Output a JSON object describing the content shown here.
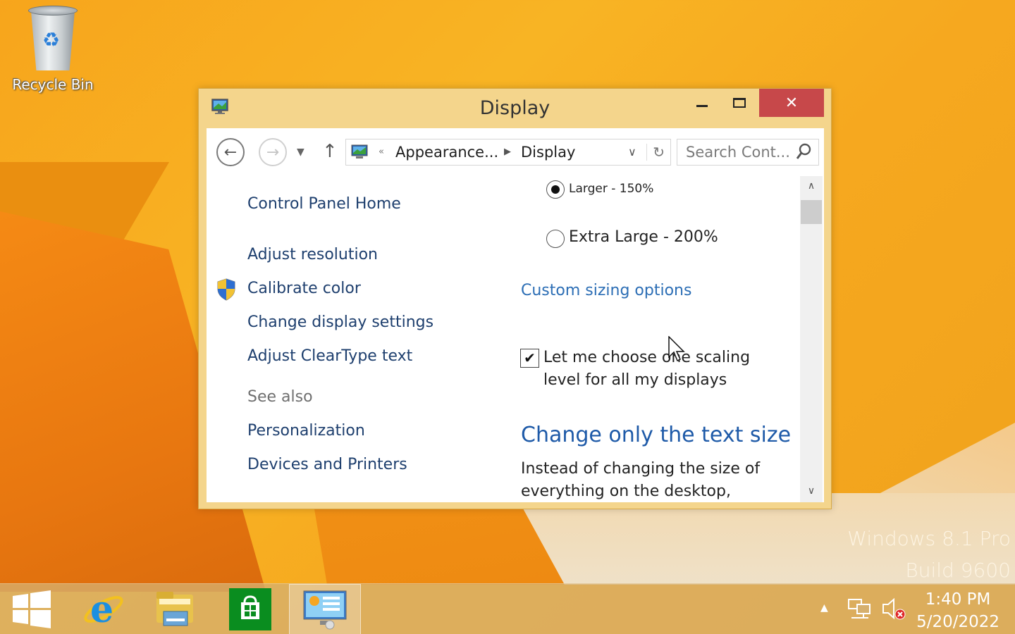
{
  "desktop": {
    "recycle_bin_label": "Recycle Bin",
    "watermark_line1": "Windows 8.1 Pro",
    "watermark_line2": "Build 9600"
  },
  "window": {
    "title": "Display",
    "close_glyph": "✕",
    "nav": {
      "back_glyph": "←",
      "forward_glyph": "→",
      "recent_glyph": "▼",
      "up_glyph": "↑",
      "breadcrumb_chevron": "«",
      "breadcrumb": [
        "Appearance...",
        "Display"
      ],
      "breadcrumb_separator": "▶",
      "address_dropdown_glyph": "∨",
      "refresh_glyph": "↻",
      "search_placeholder": "Search Cont..."
    },
    "sidebar": {
      "home": "Control Panel Home",
      "links": [
        "Adjust resolution",
        "Calibrate color",
        "Change display settings",
        "Adjust ClearType text"
      ],
      "see_also_heading": "See also",
      "see_also": [
        "Personalization",
        "Devices and Printers"
      ]
    },
    "main": {
      "options": [
        {
          "label": "Larger - 150%",
          "selected": true
        },
        {
          "label": "Extra Large - 200%",
          "selected": false
        }
      ],
      "custom_sizing_link": "Custom sizing options",
      "checkbox_checked": true,
      "checkbox_glyph": "✔",
      "checkbox_label": "Let me choose one scaling level for all my displays",
      "section_heading": "Change only the text size",
      "section_desc": "Instead of changing the size of everything on the desktop,"
    },
    "scrollbar": {
      "up_glyph": "∧",
      "down_glyph": "∨"
    }
  },
  "taskbar": {
    "apps": [
      "start-button",
      "internet-explorer",
      "file-explorer",
      "store",
      "control-panel"
    ],
    "active_app": "control-panel",
    "tray_arrow_glyph": "▲",
    "time": "1:40 PM",
    "date": "5/20/2022"
  },
  "colors": {
    "wallpaper": "#f7a51c",
    "window_frame": "#f4d58c",
    "close_button": "#c7484a",
    "link": "#2c6eb5",
    "heading": "#1e5aa8"
  }
}
